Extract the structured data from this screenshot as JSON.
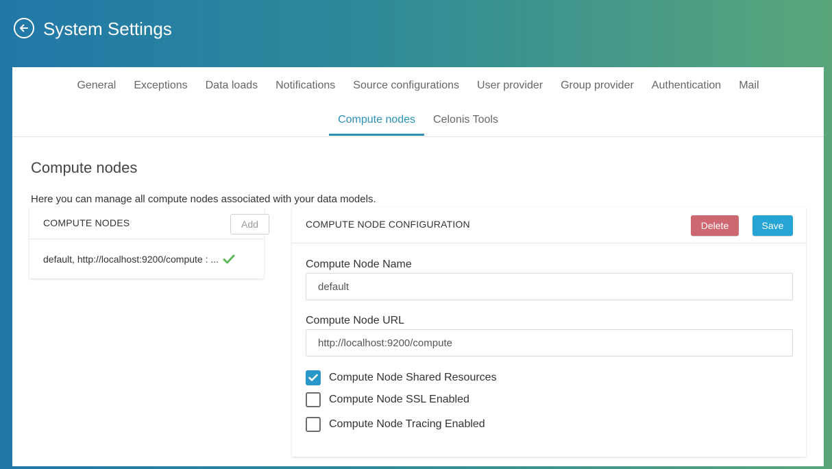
{
  "app": {
    "title": "System Settings"
  },
  "tabs": {
    "row1": [
      "General",
      "Exceptions",
      "Data loads",
      "Notifications",
      "Source configurations",
      "User provider",
      "Group provider",
      "Authentication",
      "Mail"
    ],
    "row2": [
      "Compute nodes",
      "Celonis Tools"
    ],
    "active": "Compute nodes"
  },
  "page": {
    "title": "Compute nodes",
    "description": "Here you can manage all compute nodes associated with your data models."
  },
  "nodes_panel": {
    "title": "COMPUTE NODES",
    "add_label": "Add",
    "items": [
      {
        "label": "default, http://localhost:9200/compute : ...",
        "status_icon": "check-icon"
      }
    ]
  },
  "config_panel": {
    "title": "COMPUTE NODE CONFIGURATION",
    "delete_label": "Delete",
    "save_label": "Save",
    "name_label": "Compute Node Name",
    "name_value": "default",
    "url_label": "Compute Node URL",
    "url_value": "http://localhost:9200/compute",
    "checkboxes": [
      {
        "label": "Compute Node Shared Resources",
        "checked": true
      },
      {
        "label": "Compute Node SSL Enabled",
        "checked": false
      },
      {
        "label": "Compute Node Tracing Enabled",
        "checked": false
      }
    ]
  },
  "colors": {
    "accent": "#2a8fb7",
    "delete": "#cd6873",
    "save": "#26a4d4",
    "check": "#5cb85c"
  }
}
